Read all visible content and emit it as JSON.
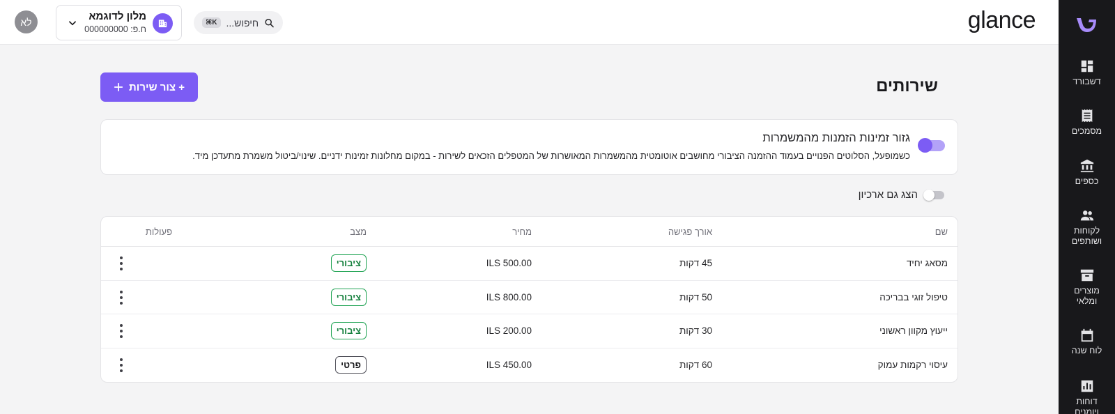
{
  "app": {
    "brand": "glance"
  },
  "colors": {
    "accent": "#7c5cf4",
    "sidebar_bg": "#18181b",
    "public_badge": "#15803d"
  },
  "sidebar": {
    "logo_icon": "glance-logo-icon",
    "items": [
      {
        "label": "דשבורד",
        "icon": "dashboard-icon"
      },
      {
        "label": "מסמכים",
        "icon": "receipt-icon"
      },
      {
        "label": "כספים",
        "icon": "bank-icon"
      },
      {
        "label_line1": "לקוחות",
        "label_line2": "ושותפים",
        "icon": "people-icon"
      },
      {
        "label_line1": "מוצרים",
        "label_line2": "ומלאי",
        "icon": "archive-icon"
      },
      {
        "label": "לוח שנה",
        "icon": "calendar-icon"
      },
      {
        "label_line1": "דוחות",
        "label_line2": "ויומנים",
        "icon": "bar-chart-icon"
      }
    ]
  },
  "topbar": {
    "search": {
      "placeholder": "חיפוש...",
      "shortcut": "⌘K"
    },
    "business": {
      "name": "מלון לדוגמא",
      "id_label": "ח.פ: 000000000"
    },
    "avatar_initials": "לא"
  },
  "page": {
    "title": "שירותים",
    "add_button_label": "+ צור שירות",
    "shift_card": {
      "title": "גזור זמינות הזמנות מהמשמרות",
      "description": "כשמופעל, הסלוטים הפנויים בעמוד ההזמנה הציבורי מחושבים אוטומטית מהמשמרות המאושרות של המטפלים הזכאים לשירות - במקום מחלונות זמינות ידניים. שינוי/ביטול משמרת מתעדכן מיד.",
      "enabled": true
    },
    "show_archive": {
      "label": "הצג גם ארכיון",
      "enabled": false
    }
  },
  "table": {
    "columns": {
      "name": "שם",
      "length": "אורך פגישה",
      "price": "מחיר",
      "status": "מצב",
      "actions": "פעולות"
    },
    "rows": [
      {
        "name": "מסאג יחיד",
        "length": "45 דקות",
        "price": "ILS 500.00",
        "status": "ציבורי",
        "status_type": "public"
      },
      {
        "name": "טיפול זוגי בבריכה",
        "length": "50 דקות",
        "price": "ILS 800.00",
        "status": "ציבורי",
        "status_type": "public"
      },
      {
        "name": "ייעוץ מקוון ראשוני",
        "length": "30 דקות",
        "price": "ILS 200.00",
        "status": "ציבורי",
        "status_type": "public"
      },
      {
        "name": "עיסוי רקמות עמוק",
        "length": "60 דקות",
        "price": "ILS 450.00",
        "status": "פרטי",
        "status_type": "private"
      }
    ]
  }
}
